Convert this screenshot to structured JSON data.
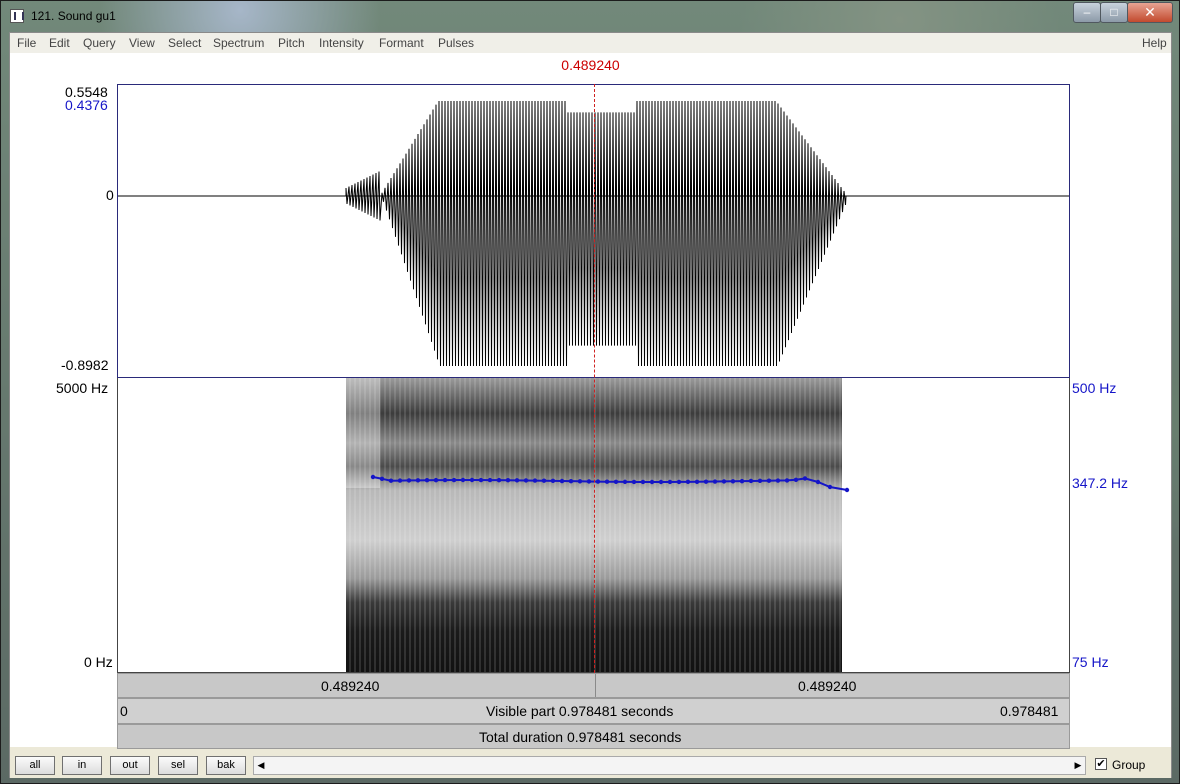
{
  "window": {
    "title": "121. Sound gu1",
    "min_icon": "minimize-icon",
    "max_icon": "maximize-icon",
    "close_icon": "close-icon"
  },
  "menu": {
    "items": [
      "File",
      "Edit",
      "Query",
      "View",
      "Select",
      "Spectrum",
      "Pitch",
      "Intensity",
      "Formant",
      "Pulses"
    ],
    "help": "Help"
  },
  "cursor": {
    "time": "0.489240"
  },
  "waveform": {
    "y_max": "0.5548",
    "y_value": "0.4376",
    "y_zero": "0",
    "y_min": "-0.8982"
  },
  "spectrogram": {
    "freq_top": "5000 Hz",
    "freq_bottom": "0 Hz",
    "pitch_top": "500 Hz",
    "pitch_value": "347.2 Hz",
    "pitch_bottom": "75 Hz"
  },
  "bars": {
    "left_time": "0.489240",
    "right_time": "0.489240",
    "visible_start": "0",
    "visible_label": "Visible part 0.978481 seconds",
    "visible_end": "0.978481",
    "total_label": "Total duration 0.978481 seconds"
  },
  "buttons": {
    "all": "all",
    "in": "in",
    "out": "out",
    "sel": "sel",
    "bak": "bak"
  },
  "group": {
    "label": "Group",
    "checked": true,
    "check_mark": "✔"
  },
  "colors": {
    "cursor": "#cc0000",
    "pitch": "#1515c8"
  }
}
